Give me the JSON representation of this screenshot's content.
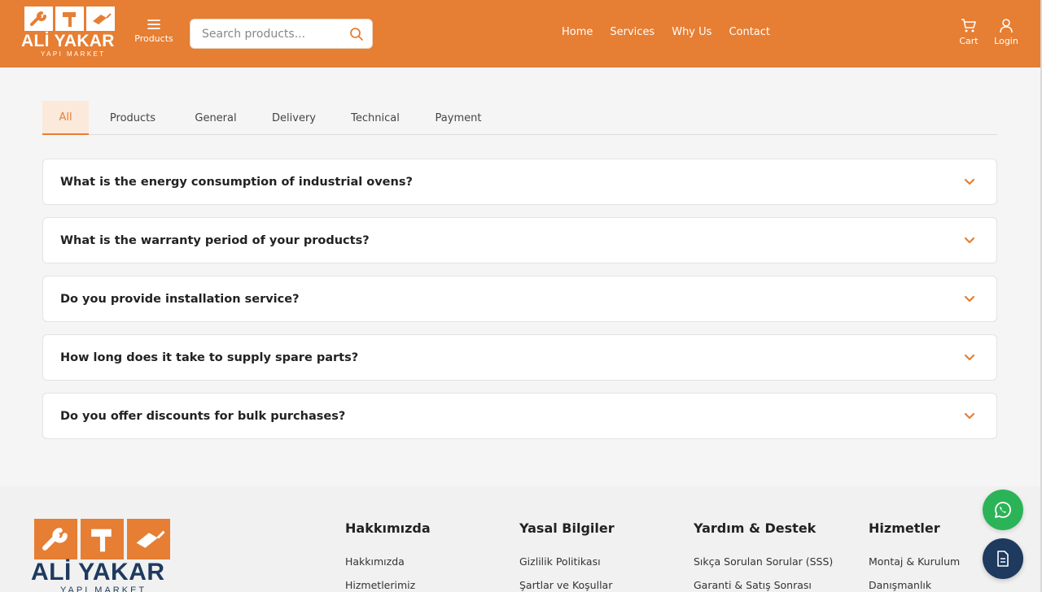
{
  "brand": {
    "name": "ALİ YAKAR",
    "sub": "YAPI MARKET",
    "accent_color": "#e67e33",
    "footer_logo_color": "#1e3a5f"
  },
  "header": {
    "products_label": "Products",
    "search_placeholder": "Search products...",
    "nav": [
      "Home",
      "Services",
      "Why Us",
      "Contact"
    ],
    "cart_label": "Cart",
    "login_label": "Login"
  },
  "tabs": [
    "All",
    "Products",
    "General",
    "Delivery",
    "Technical",
    "Payment"
  ],
  "active_tab": "All",
  "faqs": [
    "What is the energy consumption of industrial ovens?",
    "What is the warranty period of your products?",
    "Do you provide installation service?",
    "How long does it take to supply spare parts?",
    "Do you offer discounts for bulk purchases?"
  ],
  "footer": {
    "columns": [
      {
        "title": "Hakkımızda",
        "links": [
          "Hakkımızda",
          "Hizmetlerimiz"
        ]
      },
      {
        "title": "Yasal Bilgiler",
        "links": [
          "Gizlilik Politikası",
          "Şartlar ve Koşullar"
        ]
      },
      {
        "title": "Yardım & Destek",
        "links": [
          "Sıkça Sorulan Sorular (SSS)",
          "Garanti & Satış Sonrası"
        ]
      },
      {
        "title": "Hizmetler",
        "links": [
          "Montaj & Kurulum",
          "Danışmanlık"
        ]
      }
    ]
  },
  "floating": {
    "whatsapp_icon": "whatsapp-icon",
    "document_icon": "document-icon"
  }
}
